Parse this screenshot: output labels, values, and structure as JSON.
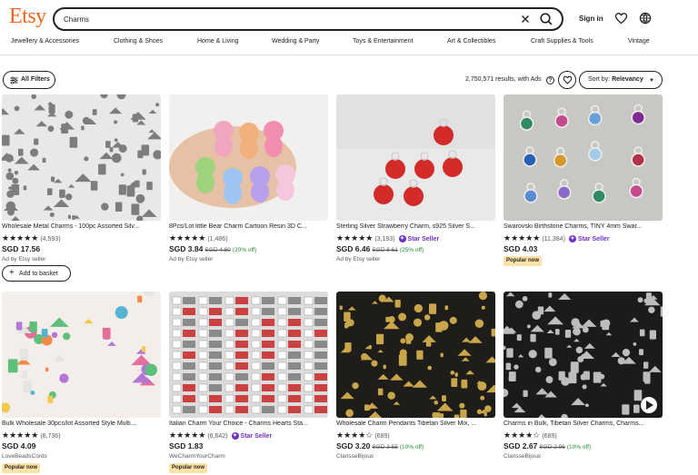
{
  "header": {
    "logo": "Etsy",
    "search_value": "Charms",
    "sign_in": "Sign in"
  },
  "categories": [
    "Jewellery & Accessories",
    "Clothing & Shoes",
    "Home & Living",
    "Wedding & Party",
    "Toys & Entertainment",
    "Art & Collectibles",
    "Craft Supplies & Tools",
    "Vintage"
  ],
  "filters": {
    "all_filters": "All Filters",
    "results": "2,750,571 results, with Ads",
    "help": "?",
    "sort_label": "Sort by:",
    "sort_value": "Relevancy"
  },
  "products": [
    {
      "title": "Wholesale Metal Charms - 100pc Assorted Silv...",
      "stars": "★★★★★",
      "count": "(4,593)",
      "star_seller": "",
      "price": "SGD 17.56",
      "old_price": "",
      "discount": "",
      "seller": "Ad by Etsy seller",
      "popular": "",
      "add_to_basket": "Add to basket",
      "colors": {
        "bg": "#e8e8e8",
        "fg": "#7d7d7d"
      }
    },
    {
      "title": "8Pcs/Lot little Bear Charm Cartoon Resin 3D C...",
      "stars": "★★★★★",
      "count": "(1,486)",
      "star_seller": "",
      "price": "SGD 3.84",
      "old_price": "SGD 4.80",
      "discount": "(20% off)",
      "seller": "Ad by Etsy seller",
      "popular": "",
      "add_to_basket": "",
      "colors": {
        "bg": "#f1f0ee",
        "fg": "#f4a8c4"
      }
    },
    {
      "title": "Sterling Silver Strawberry Charm, s925 Silver S...",
      "stars": "★★★★★",
      "count": "(3,193)",
      "star_seller": "Star Seller",
      "price": "SGD 6.46",
      "old_price": "SGD 8.61",
      "discount": "(25% off)",
      "seller": "Ad by Etsy seller",
      "popular": "",
      "add_to_basket": "",
      "colors": {
        "bg": "#e9e9ea",
        "fg": "#d32a2a"
      }
    },
    {
      "title": "Swarovski Birthstone Charms, TINY 4mm Swar...",
      "stars": "★★★★★",
      "count": "(11,384)",
      "star_seller": "Star Seller",
      "price": "SGD 4.03",
      "old_price": "",
      "discount": "",
      "seller": "",
      "popular": "Popular now",
      "add_to_basket": "",
      "colors": {
        "bg": "#c9c7c4",
        "fg": "#3b7db8"
      }
    },
    {
      "title": "Bulk Wholesale 30pcs/lot Assorted Style Multi...",
      "stars": "★★★★★",
      "count": "(8,736)",
      "star_seller": "",
      "price": "SGD 4.09",
      "old_price": "",
      "discount": "",
      "seller": "LoveBeadsCords",
      "popular": "Popular now",
      "add_to_basket": "",
      "colors": {
        "bg": "#f3eee9",
        "fg": "#e46f9a"
      }
    },
    {
      "title": "Italian Charm Your Choice - Charms Hearts Sta...",
      "stars": "★★★★★",
      "count": "(6,642)",
      "star_seller": "Star Seller",
      "price": "SGD 1.83",
      "old_price": "",
      "discount": "",
      "seller": "WeCharmYourCharm",
      "popular": "Popular now",
      "add_to_basket": "",
      "colors": {
        "bg": "#dcdcdc",
        "fg": "#c94141"
      }
    },
    {
      "title": "Wholesale Charm Pendants Tibetan Silver Mix, ...",
      "stars": "★★★★☆",
      "count": "(689)",
      "star_seller": "",
      "price": "SGD 3.20",
      "old_price": "SGD 3.55",
      "discount": "(10% off)",
      "seller": "ClarisseBijoux",
      "popular": "",
      "add_to_basket": "",
      "colors": {
        "bg": "#1f1d1a",
        "fg": "#c9a64a"
      }
    },
    {
      "title": "Charms in Bulk, Tibetan Silver Charms, Charms...",
      "stars": "★★★★☆",
      "count": "(689)",
      "star_seller": "",
      "price": "SGD 2.67",
      "old_price": "SGD 2.96",
      "discount": "(10% off)",
      "seller": "ClarisseBijoux",
      "popular": "",
      "add_to_basket": "",
      "colors": {
        "bg": "#1b1b1b",
        "fg": "#bdbdbd"
      }
    }
  ]
}
